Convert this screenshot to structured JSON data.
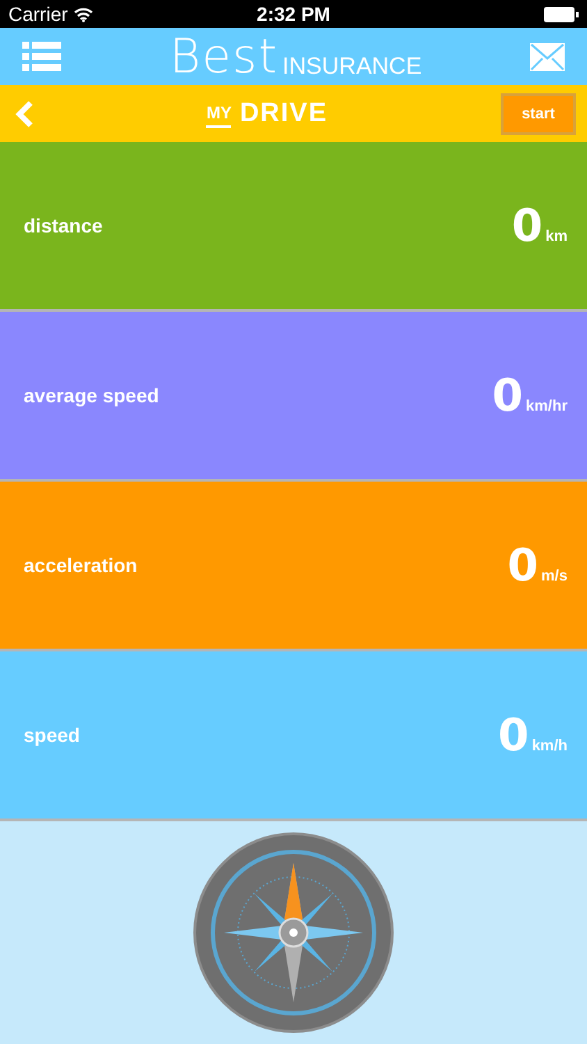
{
  "status_bar": {
    "carrier": "Carrier",
    "time": "2:32 PM"
  },
  "header": {
    "logo": "Best",
    "logo_suffix": "INSURANCE"
  },
  "subheader": {
    "title_small": "MY",
    "title": "DRIVE",
    "button": "start"
  },
  "metrics": [
    {
      "label": "distance",
      "value": "0",
      "unit": "km",
      "color": "#7ab51d"
    },
    {
      "label": "average speed",
      "value": "0",
      "unit": "km/hr",
      "color": "#8a87fe"
    },
    {
      "label": "acceleration",
      "value": "0",
      "unit": "m/s",
      "color": "#ff9900"
    },
    {
      "label": "speed",
      "value": "0",
      "unit": "km/h",
      "color": "#66ccff"
    }
  ]
}
